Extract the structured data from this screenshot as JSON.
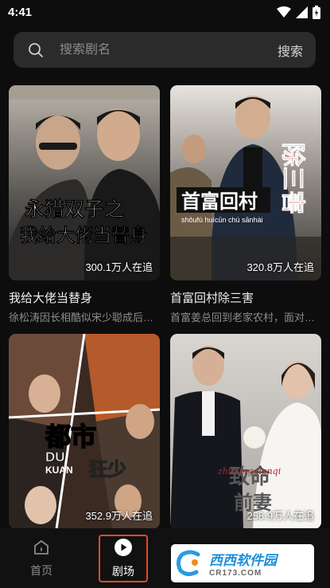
{
  "status_bar": {
    "time": "4:41"
  },
  "search": {
    "placeholder": "搜索剧名",
    "button_label": "搜索"
  },
  "shows": [
    {
      "title": "我给大佬当替身",
      "description": "徐松涛因长相酷似宋少聪成后…",
      "followers": "300.1万人在追",
      "poster_text_line1": "永猎双子之",
      "poster_text_line2": "我给大佬当替身"
    },
    {
      "title": "首富回村除三害",
      "description": "首富姜总回到老家农村，面对…",
      "followers": "320.8万人在追",
      "poster_text_main": "首富回村",
      "poster_text_pinyin": "shǒufù huícūn chú sānhài",
      "poster_text_side": "除三害"
    },
    {
      "title": "",
      "description": "",
      "followers": "352.9万人在追",
      "poster_text_main": "都市",
      "poster_text_latin1": "DU",
      "poster_text_latin2": "KUAN",
      "poster_text_side": "狂少"
    },
    {
      "title": "",
      "description": "",
      "followers": "258.9万人在追",
      "poster_text_main": "致命",
      "poster_text_sub": "前妻",
      "poster_text_script": "zhimingqianqi"
    }
  ],
  "nav": {
    "items": [
      {
        "label": "首页",
        "active": false
      },
      {
        "label": "剧场",
        "active": true
      }
    ]
  },
  "watermark": {
    "main": "西西软件园",
    "sub": "CR173.COM"
  }
}
